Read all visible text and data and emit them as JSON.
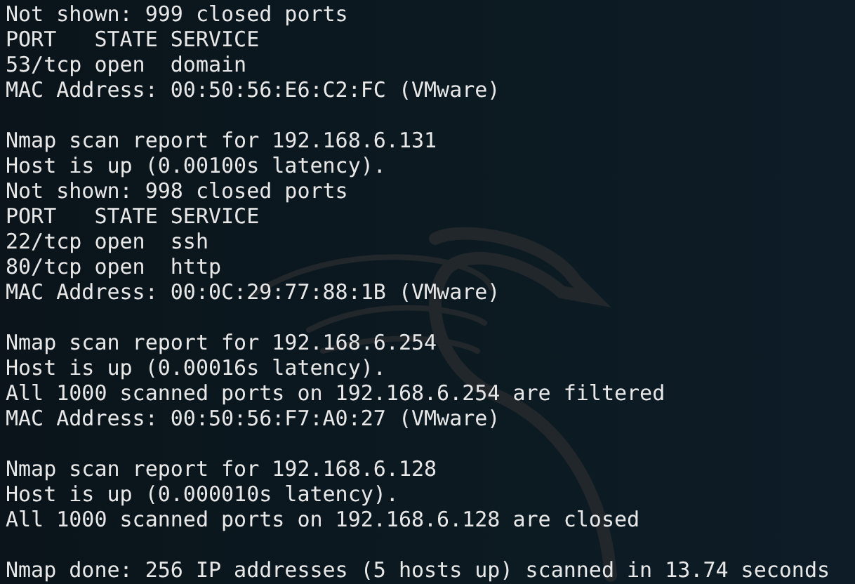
{
  "terminal": {
    "blocks": [
      {
        "lines": [
          "Not shown: 999 closed ports",
          "PORT   STATE SERVICE",
          "53/tcp open  domain",
          "MAC Address: 00:50:56:E6:C2:FC (VMware)"
        ]
      },
      {
        "lines": [
          "Nmap scan report for 192.168.6.131",
          "Host is up (0.00100s latency).",
          "Not shown: 998 closed ports",
          "PORT   STATE SERVICE",
          "22/tcp open  ssh",
          "80/tcp open  http",
          "MAC Address: 00:0C:29:77:88:1B (VMware)"
        ]
      },
      {
        "lines": [
          "Nmap scan report for 192.168.6.254",
          "Host is up (0.00016s latency).",
          "All 1000 scanned ports on 192.168.6.254 are filtered",
          "MAC Address: 00:50:56:F7:A0:27 (VMware)"
        ]
      },
      {
        "lines": [
          "Nmap scan report for 192.168.6.128",
          "Host is up (0.000010s latency).",
          "All 1000 scanned ports on 192.168.6.128 are closed"
        ]
      },
      {
        "lines": [
          "Nmap done: 256 IP addresses (5 hosts up) scanned in 13.74 seconds"
        ]
      }
    ]
  }
}
